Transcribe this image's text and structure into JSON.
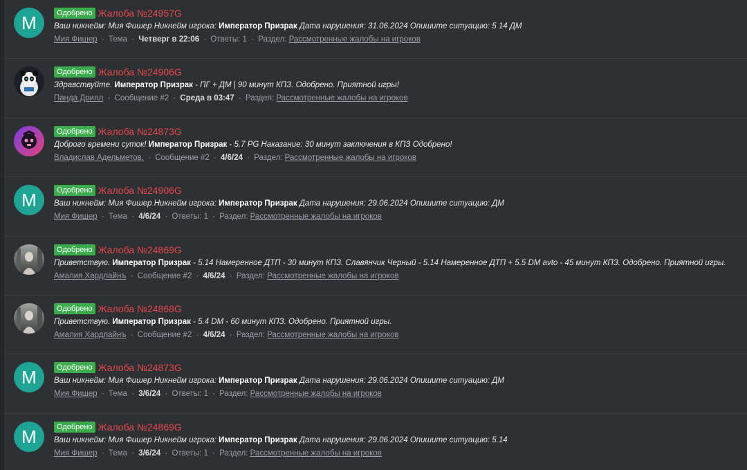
{
  "search_results": [
    {
      "badge": "Одобрено",
      "title": "Жалоба №24957G",
      "avatar": {
        "type": "letter",
        "letter": "M",
        "color": "#1ea394"
      },
      "snippet": [
        {
          "text": "Ваш никнейм: Мия Фишер Никнейм игрока: ",
          "bold": false
        },
        {
          "text": "Император Призрак",
          "bold": true
        },
        {
          "text": " Дата нарушения: 31.06.2024 Опишите ситуацию: 5 14 ДМ",
          "bold": false
        }
      ],
      "author": "Мия Фишер",
      "type": "Тема",
      "date": "Четверг в 22:06",
      "extra": "Ответы: 1",
      "section_label": "Раздел:",
      "forum": "Рассмотренные жалобы на игроков"
    },
    {
      "badge": "Одобрено",
      "title": "Жалоба №24906G",
      "avatar": {
        "type": "panda",
        "color": "#1d2028"
      },
      "snippet": [
        {
          "text": "Здравствуйте. ",
          "bold": false
        },
        {
          "text": "Император Призрак",
          "bold": true
        },
        {
          "text": " - ПГ + ДМ | 90 минут КПЗ. Одобрено. Приятной игры!",
          "bold": false
        }
      ],
      "author": "Панда Дрилл",
      "type": "Сообщение #2",
      "date": "Среда в 03:47",
      "extra": "",
      "section_label": "Раздел:",
      "forum": "Рассмотренные жалобы на игроков"
    },
    {
      "badge": "Одобрено",
      "title": "Жалоба №24873G",
      "avatar": {
        "type": "skull",
        "color": "#9a3fd0"
      },
      "snippet": [
        {
          "text": "Доброго времени суток! ",
          "bold": false
        },
        {
          "text": "Император Призрак",
          "bold": true
        },
        {
          "text": " - 5.7 PG Наказание: 30 минут заключения в КПЗ Одобрено!",
          "bold": false
        }
      ],
      "author": "Владислав Адельметов.",
      "type": "Сообщение #2",
      "date": "4/6/24",
      "extra": "",
      "section_label": "Раздел:",
      "forum": "Рассмотренные жалобы на игроков"
    },
    {
      "badge": "Одобрено",
      "title": "Жалоба №24906G",
      "avatar": {
        "type": "letter",
        "letter": "M",
        "color": "#1ea394"
      },
      "snippet": [
        {
          "text": "Ваш никнейм: Мия Фишер Никнейм игрока: ",
          "bold": false
        },
        {
          "text": "Император Призрак",
          "bold": true
        },
        {
          "text": " Дата нарушения: 29.06.2024 Опишите ситуацию: ДМ",
          "bold": false
        }
      ],
      "author": "Мия Фишер",
      "type": "Тема",
      "date": "4/6/24",
      "extra": "Ответы: 1",
      "section_label": "Раздел:",
      "forum": "Рассмотренные жалобы на игроков"
    },
    {
      "badge": "Одобрено",
      "title": "Жалоба №24869G",
      "avatar": {
        "type": "photo",
        "color": "#6e7170"
      },
      "snippet": [
        {
          "text": "Приветствую. ",
          "bold": false
        },
        {
          "text": "Император Призрак",
          "bold": true
        },
        {
          "text": " - 5.14 Намеренное ДТП - 30 минут КПЗ. Славянчик Черный - 5.14 Намеренное ДТП + 5.5 DM avto - 45 минут КПЗ. Одобрено. Приятной игры.",
          "bold": false
        }
      ],
      "author": "Амалия Хардлайнъ",
      "type": "Сообщение #2",
      "date": "4/6/24",
      "extra": "",
      "section_label": "Раздел:",
      "forum": "Рассмотренные жалобы на игроков"
    },
    {
      "badge": "Одобрено",
      "title": "Жалоба №24868G",
      "avatar": {
        "type": "photo",
        "color": "#6e7170"
      },
      "snippet": [
        {
          "text": "Приветствую. ",
          "bold": false
        },
        {
          "text": "Император Призрак",
          "bold": true
        },
        {
          "text": " - 5.4 DM - 60 минут КПЗ. Одобрено. Приятной игры.",
          "bold": false
        }
      ],
      "author": "Амалия Хардлайнъ",
      "type": "Сообщение #2",
      "date": "4/6/24",
      "extra": "",
      "section_label": "Раздел:",
      "forum": "Рассмотренные жалобы на игроков"
    },
    {
      "badge": "Одобрено",
      "title": "Жалоба №24873G",
      "avatar": {
        "type": "letter",
        "letter": "M",
        "color": "#1ea394"
      },
      "snippet": [
        {
          "text": "Ваш никнейм: Мия Фишер Никнейм игрока: ",
          "bold": false
        },
        {
          "text": "Император Призрак",
          "bold": true
        },
        {
          "text": " Дата нарушения: 29.06.2024 Опишите ситуацию: ДМ",
          "bold": false
        }
      ],
      "author": "Мия Фишер",
      "type": "Тема",
      "date": "3/6/24",
      "extra": "Ответы: 1",
      "section_label": "Раздел:",
      "forum": "Рассмотренные жалобы на игроков"
    },
    {
      "badge": "Одобрено",
      "title": "Жалоба №24869G",
      "avatar": {
        "type": "letter",
        "letter": "M",
        "color": "#1ea394"
      },
      "snippet": [
        {
          "text": "Ваш никнейм: Мия Фишер Никнейм игрока: ",
          "bold": false
        },
        {
          "text": "Император Призрак",
          "bold": true
        },
        {
          "text": " Дата нарушения: 29.06.2024 Опишите ситуацию: 5.14",
          "bold": false
        }
      ],
      "author": "Мия Фишер",
      "type": "Тема",
      "date": "3/6/24",
      "extra": "Ответы: 1",
      "section_label": "Раздел:",
      "forum": "Рассмотренные жалобы на игроков"
    }
  ]
}
